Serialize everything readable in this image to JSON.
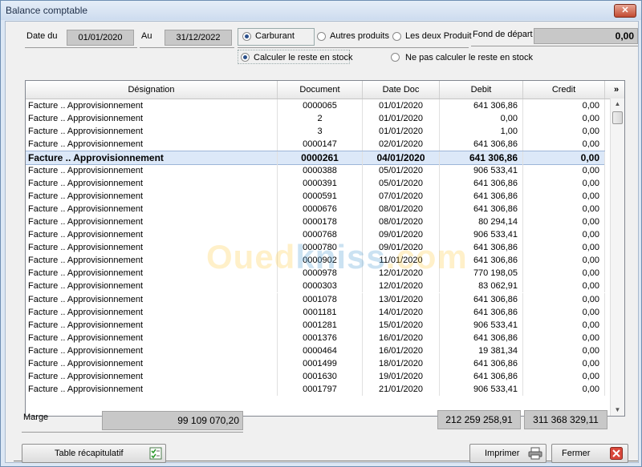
{
  "window": {
    "title": "Balance comptable",
    "close_glyph": "✕"
  },
  "filters": {
    "date_from_label": "Date du",
    "date_from_value": "01/01/2020",
    "date_to_label": "Au",
    "date_to_value": "31/12/2022",
    "product_options": [
      {
        "label": "Carburant",
        "selected": true
      },
      {
        "label": "Autres produits",
        "selected": false
      },
      {
        "label": "Les deux Produit",
        "selected": false
      }
    ],
    "fond_label": "Fond de départ",
    "fond_value": "0,00",
    "stock_options": [
      {
        "label": "Calculer le reste en stock",
        "selected": true
      },
      {
        "label": "Ne pas calculer le reste en stock",
        "selected": false
      }
    ]
  },
  "table": {
    "columns": [
      "Désignation",
      "Document",
      "Date Doc",
      "Debit",
      "Credit"
    ],
    "more_glyph": "»",
    "selected_index": 4,
    "rows": [
      [
        "Facture .. Approvisionnement",
        "0000065",
        "01/01/2020",
        "641 306,86",
        "0,00"
      ],
      [
        "Facture .. Approvisionnement",
        "2",
        "01/01/2020",
        "0,00",
        "0,00"
      ],
      [
        "Facture .. Approvisionnement",
        "3",
        "01/01/2020",
        "1,00",
        "0,00"
      ],
      [
        "Facture .. Approvisionnement",
        "0000147",
        "02/01/2020",
        "641 306,86",
        "0,00"
      ],
      [
        "Facture .. Approvisionnement",
        "0000261",
        "04/01/2020",
        "641 306,86",
        "0,00"
      ],
      [
        "Facture .. Approvisionnement",
        "0000388",
        "05/01/2020",
        "906 533,41",
        "0,00"
      ],
      [
        "Facture .. Approvisionnement",
        "0000391",
        "05/01/2020",
        "641 306,86",
        "0,00"
      ],
      [
        "Facture .. Approvisionnement",
        "0000591",
        "07/01/2020",
        "641 306,86",
        "0,00"
      ],
      [
        "Facture .. Approvisionnement",
        "0000676",
        "08/01/2020",
        "641 306,86",
        "0,00"
      ],
      [
        "Facture .. Approvisionnement",
        "0000178",
        "08/01/2020",
        "80 294,14",
        "0,00"
      ],
      [
        "Facture .. Approvisionnement",
        "0000768",
        "09/01/2020",
        "906 533,41",
        "0,00"
      ],
      [
        "Facture .. Approvisionnement",
        "0000780",
        "09/01/2020",
        "641 306,86",
        "0,00"
      ],
      [
        "Facture .. Approvisionnement",
        "0000902",
        "11/01/2020",
        "641 306,86",
        "0,00"
      ],
      [
        "Facture .. Approvisionnement",
        "0000978",
        "12/01/2020",
        "770 198,05",
        "0,00"
      ],
      [
        "Facture .. Approvisionnement",
        "0000303",
        "12/01/2020",
        "83 062,91",
        "0,00"
      ],
      [
        "Facture .. Approvisionnement",
        "0001078",
        "13/01/2020",
        "641 306,86",
        "0,00"
      ],
      [
        "Facture .. Approvisionnement",
        "0001181",
        "14/01/2020",
        "641 306,86",
        "0,00"
      ],
      [
        "Facture .. Approvisionnement",
        "0001281",
        "15/01/2020",
        "906 533,41",
        "0,00"
      ],
      [
        "Facture .. Approvisionnement",
        "0001376",
        "16/01/2020",
        "641 306,86",
        "0,00"
      ],
      [
        "Facture .. Approvisionnement",
        "0000464",
        "16/01/2020",
        "19 381,34",
        "0,00"
      ],
      [
        "Facture .. Approvisionnement",
        "0001499",
        "18/01/2020",
        "641 306,86",
        "0,00"
      ],
      [
        "Facture .. Approvisionnement",
        "0001630",
        "19/01/2020",
        "641 306,86",
        "0,00"
      ],
      [
        "Facture .. Approvisionnement",
        "0001797",
        "21/01/2020",
        "906 533,41",
        "0,00"
      ]
    ]
  },
  "watermark": {
    "part1": "Oued",
    "part2": "kniss",
    "part3": ".com"
  },
  "totals": {
    "marge_label": "Marge",
    "marge_value": "99 109 070,20",
    "debit_total": "212 259 258,91",
    "credit_total": "311 368 329,11"
  },
  "buttons": {
    "recap_label": "Table récapitulatif",
    "print_label": "Imprimer",
    "close_label": "Fermer"
  },
  "colors": {
    "selected_row": "#dce8f8",
    "close_red": "#c24a32"
  }
}
